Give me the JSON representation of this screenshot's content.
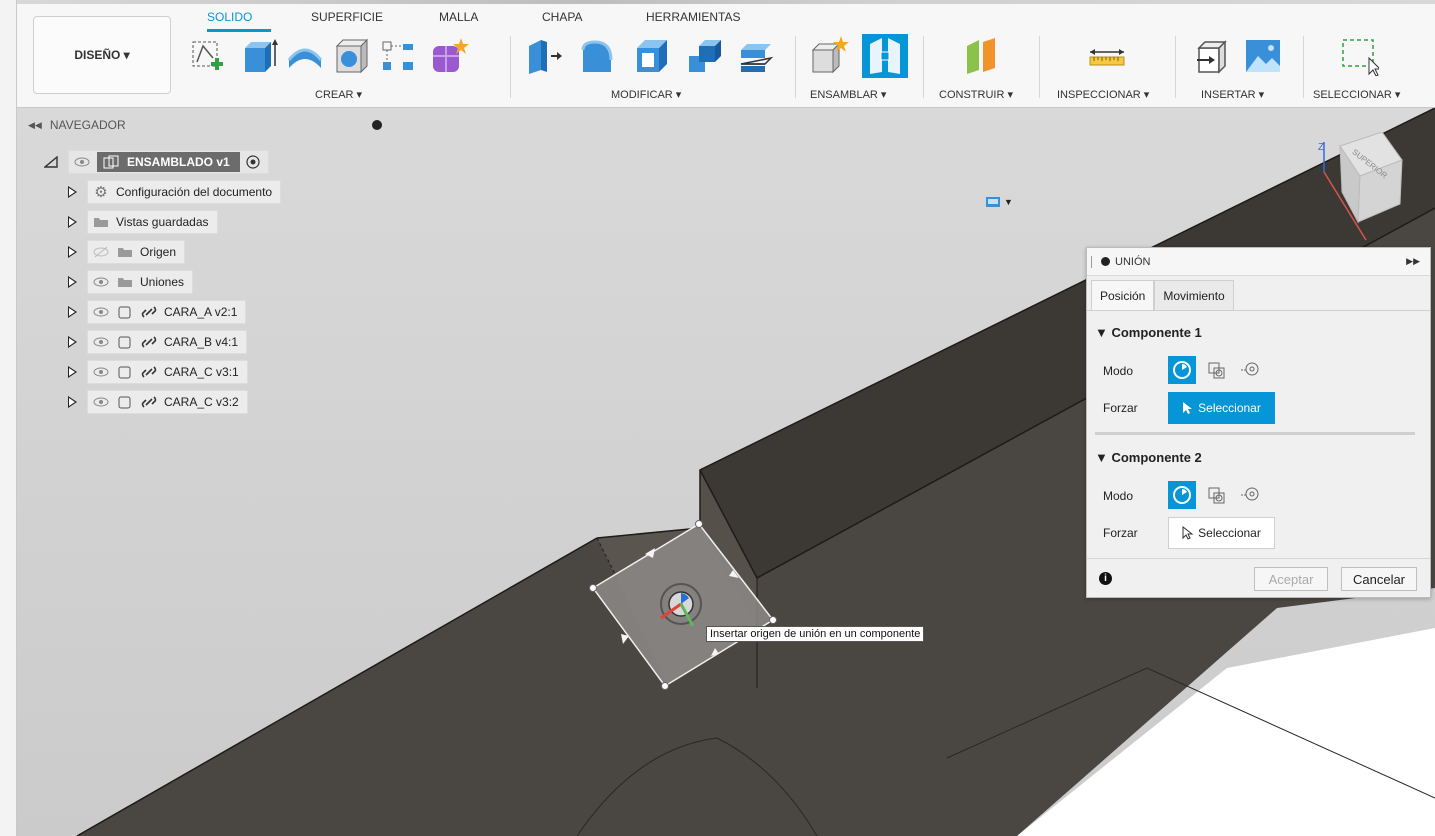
{
  "ribbon": {
    "workspace_label": "DISEÑO ▾",
    "tabs": [
      {
        "label": "SOLIDO",
        "active": true
      },
      {
        "label": "SUPERFICIE",
        "active": false
      },
      {
        "label": "MALLA",
        "active": false
      },
      {
        "label": "CHAPA",
        "active": false
      },
      {
        "label": "HERRAMIENTAS",
        "active": false
      }
    ],
    "groups": [
      "CREAR ▾",
      "MODIFICAR ▾",
      "ENSAMBLAR ▾",
      "CONSTRUIR ▾",
      "INSPECCIONAR ▾",
      "INSERTAR ▾",
      "SELECCIONAR ▾"
    ],
    "accent_color": "#0696d7"
  },
  "navigator": {
    "title": "NAVEGADOR",
    "root": "ENSAMBLADO v1",
    "items": [
      {
        "label": "Configuración del documento",
        "icon": "gear-icon"
      },
      {
        "label": "Vistas guardadas",
        "icon": "folder-icon"
      },
      {
        "label": "Origen",
        "icon": "folder-icon"
      },
      {
        "label": "Uniones",
        "icon": "folder-icon"
      },
      {
        "label": "CARA_A v2:1",
        "icon": "component-icon"
      },
      {
        "label": "CARA_B v4:1",
        "icon": "component-icon"
      },
      {
        "label": "CARA_C v3:1",
        "icon": "component-icon"
      },
      {
        "label": "CARA_C v3:2",
        "icon": "component-icon"
      }
    ]
  },
  "view_cube": {
    "face": "SUPERIOR",
    "axis_z": "Z"
  },
  "union_panel": {
    "title": "UNIÓN",
    "tabs": [
      "Posición",
      "Movimiento"
    ],
    "component1": {
      "title": "▼ Componente 1",
      "mode_label": "Modo",
      "force_label": "Forzar",
      "select_label": "Seleccionar"
    },
    "component2": {
      "title": "▼ Componente 2",
      "mode_label": "Modo",
      "force_label": "Forzar",
      "select_label": "Seleccionar"
    },
    "ok_label": "Aceptar",
    "cancel_label": "Cancelar"
  },
  "tooltip": "Insertar origen de unión en un componente"
}
